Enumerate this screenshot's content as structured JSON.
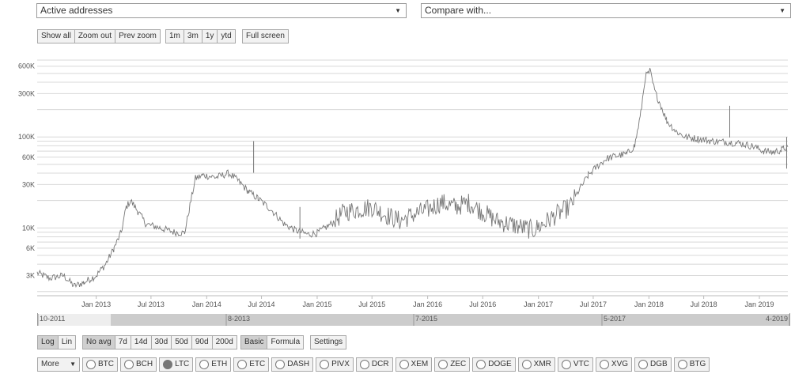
{
  "metric_select": {
    "value": "Active addresses"
  },
  "compare_select": {
    "value": "Compare with..."
  },
  "zoom_buttons": [
    "Show all",
    "Zoom out",
    "Prev zoom"
  ],
  "range_buttons": [
    "1m",
    "3m",
    "1y",
    "ytd"
  ],
  "fullscreen_label": "Full screen",
  "scale_buttons": [
    "Log",
    "Lin"
  ],
  "scale_active": "Log",
  "avg_buttons": [
    "No avg",
    "7d",
    "14d",
    "30d",
    "50d",
    "90d",
    "200d"
  ],
  "avg_active": "No avg",
  "mode_buttons": [
    "Basic",
    "Formula"
  ],
  "mode_active": "Basic",
  "settings_label": "Settings",
  "more_label": "More",
  "coins": [
    "BTC",
    "BCH",
    "LTC",
    "ETH",
    "ETC",
    "DASH",
    "PIVX",
    "DCR",
    "XEM",
    "ZEC",
    "DOGE",
    "XMR",
    "VTC",
    "XVG",
    "DGB",
    "BTG"
  ],
  "selected_coin": "LTC",
  "navigator_labels": [
    "10-2011",
    "8-2013",
    "7-2015",
    "5-2017",
    "4-2019"
  ],
  "colors": {
    "line": "#777777",
    "grid": "#d8d8d8",
    "navigator_fill": "#cccccc"
  },
  "chart_data": {
    "type": "line",
    "title": "",
    "scale": "log",
    "grid": true,
    "yticks": [
      "600K",
      "300K",
      "100K",
      "60K",
      "30K",
      "10K",
      "6K",
      "3K"
    ],
    "ytick_values": [
      600000,
      300000,
      100000,
      60000,
      30000,
      10000,
      6000,
      3000
    ],
    "xticks": [
      "Jan 2013",
      "Jul 2013",
      "Jan 2014",
      "Jul 2014",
      "Jan 2015",
      "Jul 2015",
      "Jan 2016",
      "Jul 2016",
      "Jan 2017",
      "Jul 2017",
      "Jan 2018",
      "Jul 2018",
      "Jan 2019"
    ],
    "xlim": [
      "2012-06-20",
      "2019-04-05"
    ],
    "ylim": [
      1800,
      700000
    ],
    "series": [
      {
        "values": [
          [
            "2012-06-20",
            3200
          ],
          [
            "2012-08-01",
            2800
          ],
          [
            "2012-09-15",
            3000
          ],
          [
            "2012-10-20",
            2300
          ],
          [
            "2012-11-20",
            2500
          ],
          [
            "2013-01-01",
            3000
          ],
          [
            "2013-02-01",
            4000
          ],
          [
            "2013-03-01",
            6000
          ],
          [
            "2013-03-25",
            9000
          ],
          [
            "2013-04-10",
            17000
          ],
          [
            "2013-04-25",
            20000
          ],
          [
            "2013-05-20",
            15000
          ],
          [
            "2013-06-15",
            11000
          ],
          [
            "2013-08-01",
            10000
          ],
          [
            "2013-09-15",
            9000
          ],
          [
            "2013-10-20",
            8800
          ],
          [
            "2013-11-10",
            20000
          ],
          [
            "2013-11-25",
            35000
          ],
          [
            "2013-12-20",
            38000
          ],
          [
            "2014-02-01",
            36000
          ],
          [
            "2014-03-15",
            40000
          ],
          [
            "2014-04-15",
            33000
          ],
          [
            "2014-05-20",
            25000
          ],
          [
            "2014-06-20",
            21000
          ],
          [
            "2014-08-01",
            16000
          ],
          [
            "2014-09-15",
            11000
          ],
          [
            "2014-10-20",
            9500
          ],
          [
            "2014-12-01",
            8500
          ],
          [
            "2015-01-01",
            8800
          ],
          [
            "2015-02-15",
            11000
          ],
          [
            "2015-04-01",
            15000
          ],
          [
            "2015-05-15",
            16000
          ],
          [
            "2015-07-01",
            17000
          ],
          [
            "2015-08-15",
            14000
          ],
          [
            "2015-10-01",
            12000
          ],
          [
            "2015-11-15",
            14000
          ],
          [
            "2016-01-01",
            16000
          ],
          [
            "2016-02-15",
            19000
          ],
          [
            "2016-04-01",
            17000
          ],
          [
            "2016-05-15",
            19000
          ],
          [
            "2016-07-01",
            15000
          ],
          [
            "2016-08-15",
            12000
          ],
          [
            "2016-10-01",
            11000
          ],
          [
            "2016-11-15",
            10000
          ],
          [
            "2016-12-15",
            9500
          ],
          [
            "2017-01-15",
            11000
          ],
          [
            "2017-03-01",
            14000
          ],
          [
            "2017-04-15",
            17000
          ],
          [
            "2017-05-15",
            26000
          ],
          [
            "2017-06-15",
            38000
          ],
          [
            "2017-07-15",
            48000
          ],
          [
            "2017-08-15",
            58000
          ],
          [
            "2017-09-15",
            62000
          ],
          [
            "2017-10-20",
            65000
          ],
          [
            "2017-11-15",
            80000
          ],
          [
            "2017-12-05",
            180000
          ],
          [
            "2017-12-20",
            460000
          ],
          [
            "2018-01-05",
            530000
          ],
          [
            "2018-01-20",
            320000
          ],
          [
            "2018-02-10",
            220000
          ],
          [
            "2018-03-01",
            150000
          ],
          [
            "2018-04-01",
            115000
          ],
          [
            "2018-05-01",
            100000
          ],
          [
            "2018-06-15",
            95000
          ],
          [
            "2018-08-01",
            90000
          ],
          [
            "2018-09-15",
            88000
          ],
          [
            "2018-11-01",
            85000
          ],
          [
            "2018-12-15",
            78000
          ],
          [
            "2019-01-15",
            70000
          ],
          [
            "2019-02-15",
            68000
          ],
          [
            "2019-03-15",
            72000
          ],
          [
            "2019-04-05",
            78000
          ]
        ]
      }
    ],
    "annotations": [
      {
        "date": "2014-06-05",
        "value": 90000
      },
      {
        "date": "2014-11-05",
        "value": 17000
      },
      {
        "date": "2018-09-25",
        "value": 220000
      },
      {
        "date": "2019-04-01",
        "value": 100000
      }
    ]
  }
}
